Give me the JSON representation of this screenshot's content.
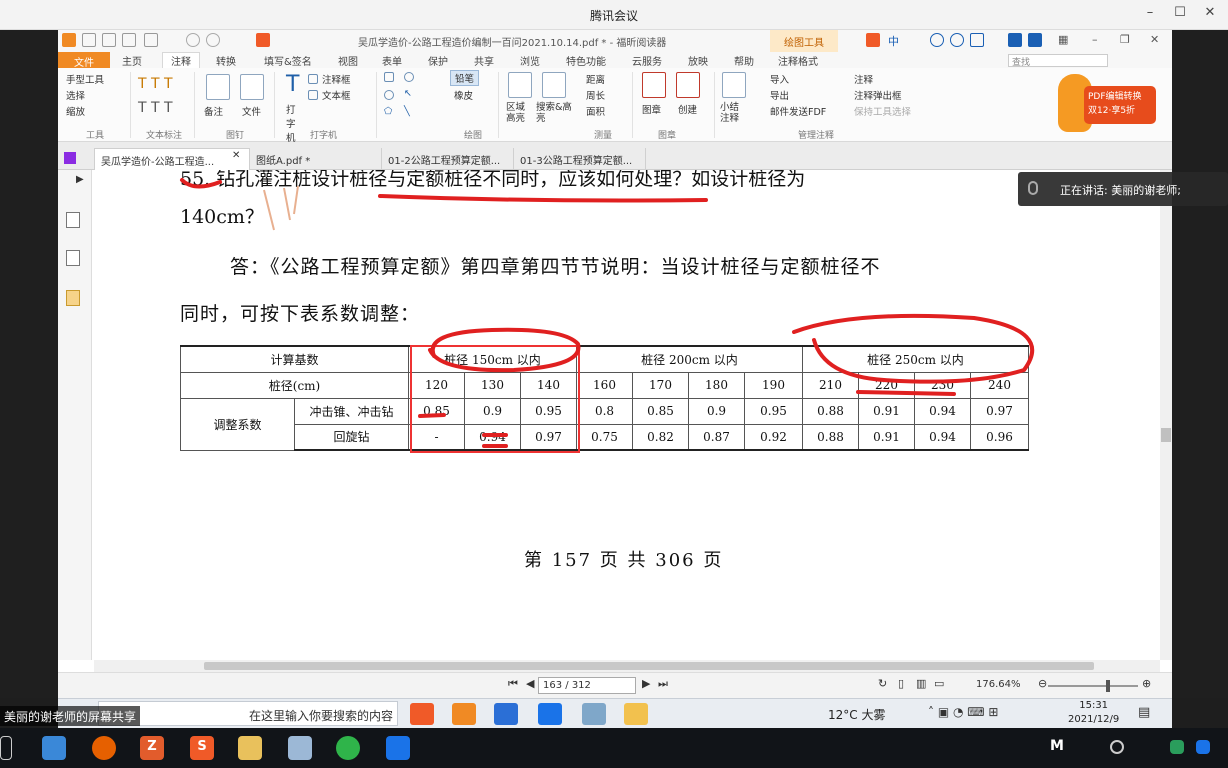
{
  "meeting": {
    "title": "腾讯会议",
    "speaking": "正在讲话: 美丽的谢老师;",
    "share_label": "美丽的谢老师的屏幕共享"
  },
  "app": {
    "doc_title": "吴瓜学造价-公路工程造价编制一百问2021.10.14.pdf * - 福昕阅读器",
    "contextual_tab": "绘图工具",
    "tabs": [
      "文件",
      "主页",
      "注释",
      "转换",
      "填写&签名",
      "视图",
      "表单",
      "保护",
      "共享",
      "浏览",
      "特色功能",
      "云服务",
      "放映",
      "帮助",
      "注释格式"
    ],
    "active_tab": "注释",
    "search_placeholder": "查找"
  },
  "ribbon": {
    "tools": [
      "手型工具",
      "选择",
      "缩放"
    ],
    "groups": [
      "工具",
      "文本标注",
      "图钉",
      "打字机",
      "绘图",
      "测量",
      "图章",
      "管理注释"
    ],
    "pin": [
      "备注",
      "文件"
    ],
    "typewriter": [
      "打字机",
      "注释框",
      "文本框"
    ],
    "draw": [
      "铅笔",
      "橡皮"
    ],
    "measure": [
      "区域高亮",
      "搜索&高亮",
      "距离",
      "周长",
      "面积"
    ],
    "stamp": [
      "图章",
      "创建"
    ],
    "manage": [
      "小结注释",
      "导入",
      "导出",
      "邮件发送FDF",
      "注释",
      "注释弹出框",
      "保持工具选择"
    ],
    "promo": "PDF编辑转换 双12·享5折"
  },
  "doctabs": [
    {
      "label": "吴瓜学造价-公路工程造...",
      "active": true
    },
    {
      "label": "图纸A.pdf *",
      "active": false
    },
    {
      "label": "01-2公路工程预算定额...",
      "active": false
    },
    {
      "label": "01-3公路工程预算定额...",
      "active": false
    }
  ],
  "page": {
    "question_line1": "55. 钻孔灌注桩设计桩径与定额桩径不同时，应该如何处理？如设计桩径为",
    "question_line2": "140cm？",
    "answer_line1": "答：《公路工程预算定额》第四章第四节节说明：当设计桩径与定额桩径不",
    "answer_line2": "同时，可按下表系数调整：",
    "page_number": "第 157 页 共 306 页"
  },
  "table": {
    "header_label": "计算基数",
    "groups": [
      "桩径 150cm 以内",
      "桩径 200cm 以内",
      "桩径 250cm 以内"
    ],
    "diameter_label": "桩径(cm)",
    "diameters": [
      "120",
      "130",
      "140",
      "160",
      "170",
      "180",
      "190",
      "210",
      "220",
      "230",
      "240"
    ],
    "coef_label": "调整系数",
    "rows": [
      {
        "name": "冲击锥、冲击钻",
        "values": [
          "0.85",
          "0.9",
          "0.95",
          "0.8",
          "0.85",
          "0.9",
          "0.95",
          "0.88",
          "0.91",
          "0.94",
          "0.97"
        ]
      },
      {
        "name": "回旋钻",
        "values": [
          "-",
          "0.94",
          "0.97",
          "0.75",
          "0.82",
          "0.87",
          "0.92",
          "0.88",
          "0.91",
          "0.94",
          "0.96"
        ]
      }
    ]
  },
  "status": {
    "page_box": "163 / 312",
    "zoom": "176.64%"
  },
  "taskbar": {
    "search_text": "在这里输入你要搜索的内容",
    "weather": "12°C 大雾",
    "time": "15:31",
    "date": "2021/12/9"
  },
  "colors": {
    "accent": "#f08a24",
    "annotation_red": "#e02020"
  }
}
